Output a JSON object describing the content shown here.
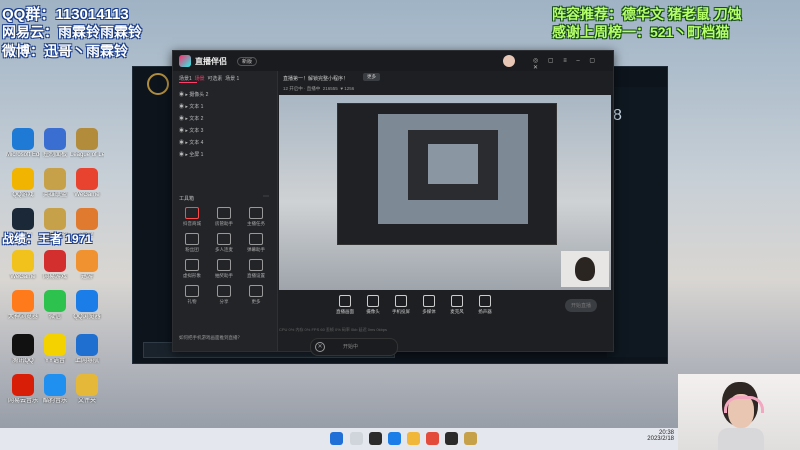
{
  "overlay": {
    "qq": "QQ群：113014113",
    "netease": "网易云：雨霖铃雨霖铃",
    "weibo": "微博：迅哥丶雨霖铃",
    "battle": "战绩：王者 1971",
    "recommend": "阵容推荐：德华文 猪老鼠 刀蚀",
    "thanks": "感谢上周榜一：521丶町档猫"
  },
  "desktop_icons": [
    {
      "label": "Microsoft Edge",
      "color": "#1f7ad6"
    },
    {
      "label": "控制面板",
      "color": "#3a6fd1"
    },
    {
      "label": "League of Legends",
      "color": "#b28b3b"
    },
    {
      "label": "QQ游戏",
      "color": "#f1b400"
    },
    {
      "label": "英雄联盟",
      "color": "#c6a14a"
    },
    {
      "label": "WeGame",
      "color": "#e8432f"
    },
    {
      "label": "Steam",
      "color": "#1b2838"
    },
    {
      "label": "英雄联盟",
      "color": "#c6a14a"
    },
    {
      "label": "狐狸",
      "color": "#e07a2e"
    },
    {
      "label": "WeGame",
      "color": "#f1c21b"
    },
    {
      "label": "网易游戏",
      "color": "#d32f2f"
    },
    {
      "label": "迅游",
      "color": "#f0922f"
    },
    {
      "label": "大神浏览器",
      "color": "#ff7a1a"
    },
    {
      "label": "微信",
      "color": "#2dc14e"
    },
    {
      "label": "QQ浏览器",
      "color": "#1a7de8"
    },
    {
      "label": "腾讯QQ",
      "color": "#111111"
    },
    {
      "label": "YY语音",
      "color": "#f3d200"
    },
    {
      "label": "上网导航",
      "color": "#1f6fd1"
    },
    {
      "label": "网易云音乐",
      "color": "#d81e06"
    },
    {
      "label": "酷狗音乐",
      "color": "#1f8ff0"
    },
    {
      "label": "文件夹",
      "color": "#e6b83a"
    }
  ],
  "app": {
    "name": "直播伴侣",
    "badge": "新版",
    "user": "雨霖铃",
    "tabs": [
      "场景1",
      "场景",
      "可选素",
      "场景 1"
    ],
    "scenes": [
      "摄像头 2",
      "文本 1",
      "文本 2",
      "文本 3",
      "文本 4",
      "全屏 1"
    ],
    "tools_title": "工具箱",
    "tools": [
      {
        "label": "抖音商城"
      },
      {
        "label": "房管助手"
      },
      {
        "label": "主播任务"
      },
      {
        "label": "粉丝团"
      },
      {
        "label": "多人连麦"
      },
      {
        "label": "弹幕助手"
      },
      {
        "label": "虚拟形象"
      },
      {
        "label": "抽奖助手"
      },
      {
        "label": "直播设置"
      },
      {
        "label": "礼物"
      },
      {
        "label": "分享"
      },
      {
        "label": "更多"
      }
    ],
    "hint": "如何把手机游戏画面推到直播？",
    "notice": "直播第一！解锁完整小程序！",
    "notice_btn": "更多",
    "room_info": "12 开启中 · 直播中",
    "viewers": "216555",
    "likes": "1256",
    "controls": [
      "直播画面",
      "摄像头",
      "手机投屏",
      "多媒体",
      "麦克风",
      "扬声器"
    ],
    "start_btn": "开始直播",
    "stats": "CPU 0%  内存 0%  FPS 60  丢帧 0%  码率 0kb  延迟 0ms  0kbps",
    "bottom_btn": "开始中"
  },
  "taskbar": {
    "time": "20:38",
    "date": "2023/2/18"
  }
}
